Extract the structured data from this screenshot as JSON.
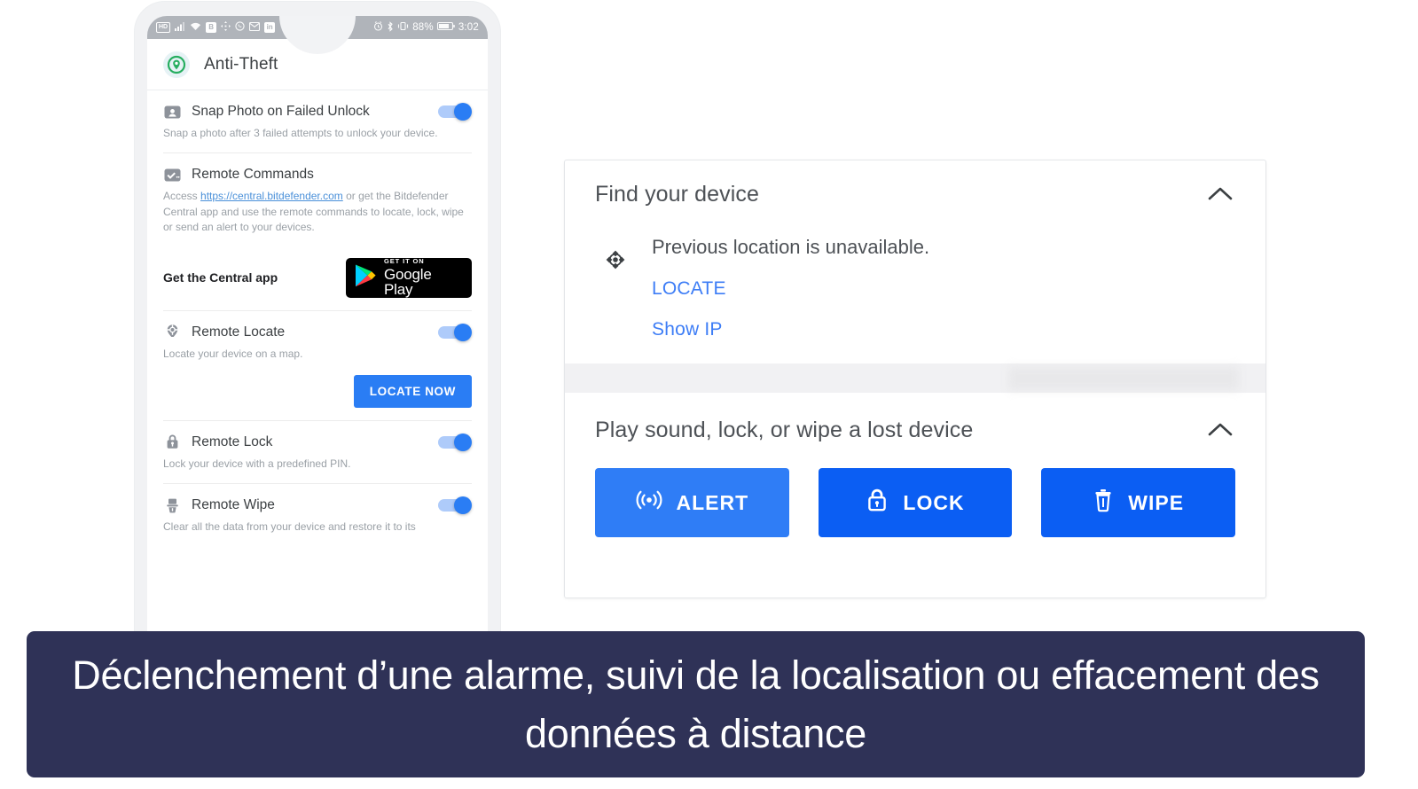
{
  "phone": {
    "statusbar": {
      "left_icons": [
        "hd-icon",
        "signal-icon",
        "wifi-icon",
        "bitdefender-icon",
        "move-icon",
        "whatsapp-icon",
        "mail-icon",
        "linkedin-icon"
      ],
      "hd_label": "HD",
      "bitdefender_label": "B",
      "linkedin_label": "in",
      "right_icons": [
        "alarm-icon",
        "bluetooth-icon",
        "vibrate-icon",
        "battery-icon"
      ],
      "battery_percent": "88%",
      "clock": "3:02"
    },
    "header": {
      "title": "Anti-Theft",
      "logo_icon": "location-pin-icon"
    },
    "rows": [
      {
        "icon": "camera-person-icon",
        "label": "Snap Photo on Failed Unlock",
        "description": "Snap a photo after 3 failed attempts to unlock your device.",
        "toggle_on": true
      },
      {
        "icon": "checkbox-check-icon",
        "label": "Remote Commands",
        "description_pre": "Access ",
        "link_text": "https://central.bitdefender.com",
        "description_post": " or get the Bitdefender Central app and use the remote commands to locate, lock, wipe or send an alert to your devices.",
        "toggle_on": false
      },
      {
        "icon": "locate-pin-icon",
        "label": "Remote Locate",
        "description": "Locate your device on a map.",
        "toggle_on": true
      },
      {
        "icon": "lock-icon",
        "label": "Remote Lock",
        "description": "Lock your device with a predefined PIN.",
        "toggle_on": true
      },
      {
        "icon": "wipe-icon",
        "label": "Remote Wipe",
        "description": "Clear all the data from your device and restore it to its",
        "toggle_on": true
      }
    ],
    "central_app": {
      "label": "Get the Central app",
      "badge_sup": "GET IT ON",
      "badge_name": "Google Play",
      "badge_icon": "google-play-triangle-icon"
    },
    "locate_now_button": "LOCATE NOW"
  },
  "card": {
    "section1": {
      "title": "Find your device",
      "collapse_icon": "chevron-up-icon",
      "status_icon": "crosshair-target-icon",
      "status_text": "Previous location is unavailable.",
      "links": [
        {
          "label": "LOCATE",
          "name": "locate-link"
        },
        {
          "label": "Show IP",
          "name": "show-ip-link"
        }
      ]
    },
    "section2": {
      "title": "Play sound, lock, or wipe a lost device",
      "collapse_icon": "chevron-up-icon",
      "buttons": [
        {
          "label": "ALERT",
          "icon": "broadcast-icon",
          "color": "#2f7df6",
          "name": "alert-button"
        },
        {
          "label": "LOCK",
          "icon": "padlock-icon",
          "color": "#0b5ef3",
          "name": "lock-button"
        },
        {
          "label": "WIPE",
          "icon": "trash-icon",
          "color": "#0b5ef3",
          "name": "wipe-button"
        }
      ]
    }
  },
  "caption": {
    "text": "Déclenchement d’une alarme, suivi de la localisation ou effacement des données à distance",
    "background": "#2f3257",
    "color": "#ffffff"
  }
}
